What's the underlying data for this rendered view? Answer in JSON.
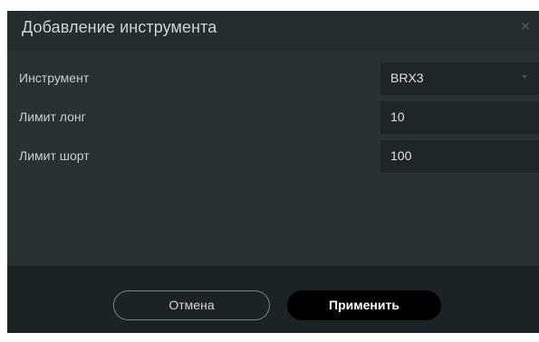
{
  "dialog": {
    "title": "Добавление инструмента",
    "close_symbol": "×"
  },
  "fields": [
    {
      "label": "Инструмент",
      "value": "BRX3",
      "type": "select"
    },
    {
      "label": "Лимит лонг",
      "value": "10",
      "type": "input"
    },
    {
      "label": "Лимит шорт",
      "value": "100",
      "type": "input"
    }
  ],
  "buttons": {
    "cancel": "Отмена",
    "apply": "Применить"
  },
  "icons": {
    "close": "close-icon",
    "dropdown": "chevron-down-icon"
  }
}
